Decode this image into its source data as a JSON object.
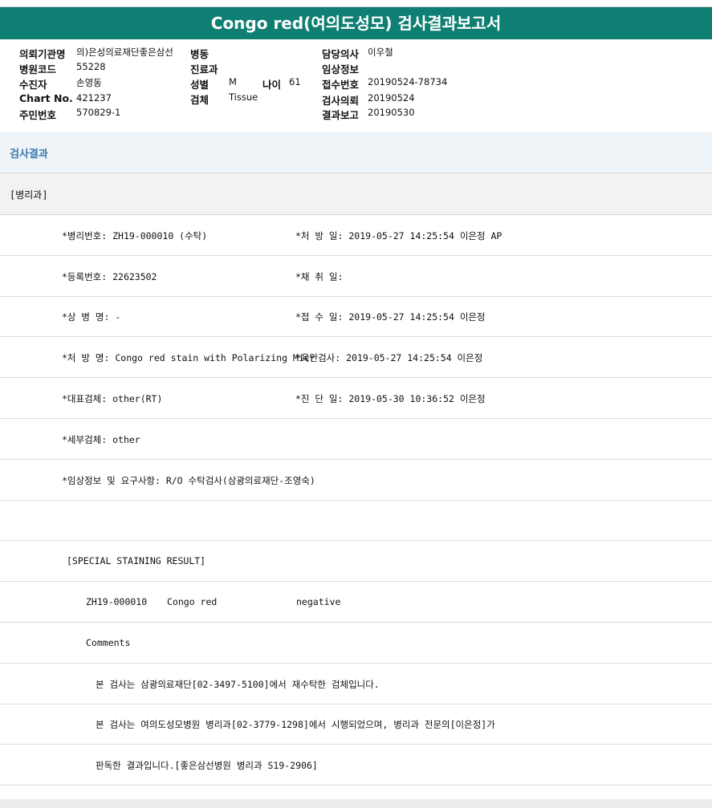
{
  "title": "Congo red(여의도성모) 검사결과보고서",
  "header": {
    "institution_label": "의뢰기관명",
    "institution_value": "의)은성의료재단좋은삼선",
    "ward_label": "병동",
    "doctor_label": "담당의사",
    "doctor_value": "이우철",
    "hospital_code_label": "병원코드",
    "hospital_code_value": "55228",
    "department_label": "진료과",
    "clinical_info_label": "임상정보",
    "collector_label": "수진자",
    "collector_value": "손영동",
    "sex_label": "성별",
    "sex_value": "M",
    "age_label": "나이",
    "age_value": "61",
    "receipt_label": "접수번호",
    "receipt_value": "20190524-78734",
    "chart_label": "Chart No.",
    "chart_value": "421237",
    "specimen_label": "검체",
    "specimen_value": "Tissue",
    "request_label": "검사의뢰",
    "request_value": "20190524",
    "id_label": "주민번호",
    "id_value": "570829-1",
    "report_label": "결과보고",
    "report_value": "20190530"
  },
  "section_title": "검사결과",
  "department": "[병리과]",
  "rows": [
    {
      "left": "*병리번호: ZH19-000010 (수탁)",
      "right": "*처 방 일: 2019-05-27 14:25:54  이은정 AP"
    },
    {
      "left": "*등록번호: 22623502",
      "right": "*채 취 일:"
    },
    {
      "left": "*상 병 명: -",
      "right": "*접 수 일: 2019-05-27 14:25:54  이은정"
    },
    {
      "left": "*처 방 명: Congo red stain with Polarizing Micr",
      "right": "*육안검사: 2019-05-27 14:25:54  이은정"
    },
    {
      "left": "*대표검체: other(RT)",
      "right": "*진 단 일: 2019-05-30 10:36:52  이은정"
    },
    {
      "left": "*세부검체: other",
      "right": ""
    },
    {
      "left": "*임상정보 및 요구사항: R/O 수탁검사(삼광의료재단-조영숙)",
      "right": ""
    }
  ],
  "result": {
    "heading": "[SPECIAL STAINING RESULT]",
    "case_no": "ZH19-000010",
    "stain": "Congo red",
    "outcome": "negative",
    "comments_label": "Comments",
    "comment1": "본 검사는 삼광의료재단[02-3497-5100]에서 재수탁한 검체입니다.",
    "comment2": "본 검사는 여의도성모병원 병리과[02-3779-1298]에서 시행되었으며, 병리과 전문의[이은정]가",
    "comment3": "판독한 결과입니다.[좋은삼선병원 병리과 S19-2906]"
  }
}
